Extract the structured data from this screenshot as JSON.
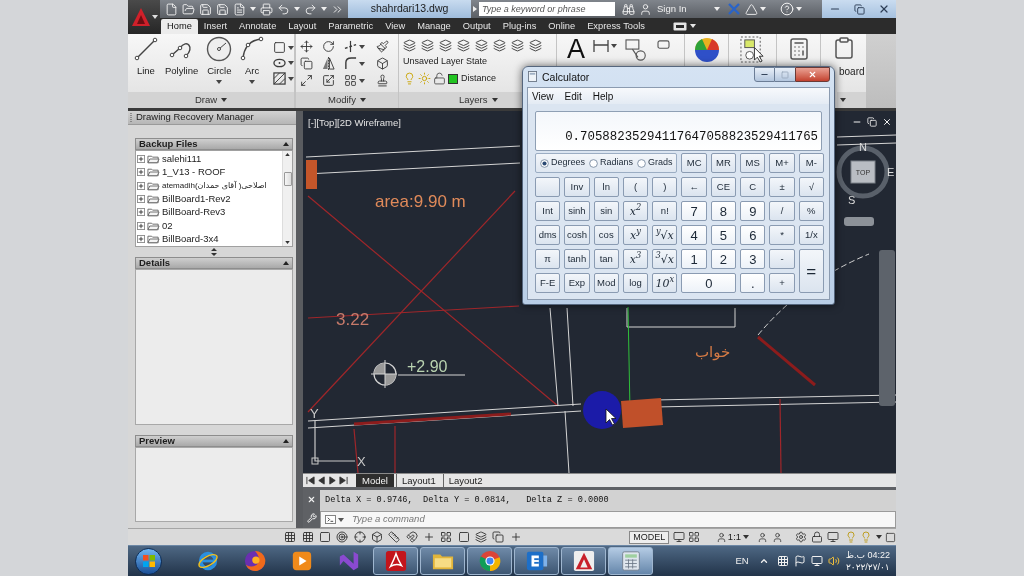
{
  "title_bar": {
    "title": "shahrdari13.dwg",
    "search": {
      "placeholder": "Type a keyword or phrase"
    },
    "sign_in": "Sign In"
  },
  "ribbon": {
    "tabs": [
      {
        "label": "Home",
        "selected": true
      },
      {
        "label": "Insert",
        "selected": false
      },
      {
        "label": "Annotate",
        "selected": false
      },
      {
        "label": "Layout",
        "selected": false
      },
      {
        "label": "Parametric",
        "selected": false
      },
      {
        "label": "View",
        "selected": false
      },
      {
        "label": "Manage",
        "selected": false
      },
      {
        "label": "Output",
        "selected": false
      },
      {
        "label": "Plug-ins",
        "selected": false
      },
      {
        "label": "Online",
        "selected": false
      },
      {
        "label": "Express Tools",
        "selected": false
      }
    ],
    "draw": {
      "label": "Draw",
      "tools": [
        "Line",
        "Polyline",
        "Circle",
        "Arc"
      ]
    },
    "modify": {
      "label": "Modify"
    },
    "layers": {
      "label": "Layers",
      "layer_state": "Unsaved Layer State",
      "current_layer": "Distance"
    },
    "annotation": {
      "text_tool": "A"
    },
    "clipboard": {
      "label": "board"
    }
  },
  "recovery_manager": {
    "title": "Drawing Recovery Manager",
    "backup_files": {
      "title": "Backup Files",
      "files": [
        {
          "name": "salehi111",
          "expanded": false
        },
        {
          "name": "1_V13 - ROOF",
          "expanded": false
        },
        {
          "name": "atemadih(اصلاحی( آقای حمدان",
          "expanded": false
        },
        {
          "name": "BillBoard1-Rev2",
          "expanded": false
        },
        {
          "name": "BillBoard-Rev3",
          "expanded": false
        },
        {
          "name": "02",
          "expanded": false
        },
        {
          "name": "BillBoard-3x4",
          "expanded": false
        }
      ]
    },
    "details": {
      "title": "Details"
    },
    "preview": {
      "title": "Preview"
    }
  },
  "viewport": {
    "label": "[-][Top][2D Wireframe]",
    "annotations": [
      "area:9.90 m",
      "3.22",
      "+2.90",
      "خواب"
    ],
    "viewcube": {
      "north": "N",
      "top": "TOP",
      "east": "E",
      "south": "S"
    },
    "ucs": {
      "y": "Y",
      "x": "X"
    }
  },
  "layout_tabs": [
    {
      "label": "Model",
      "selected": true
    },
    {
      "label": "Layout1",
      "selected": false
    },
    {
      "label": "Layout2",
      "selected": false
    }
  ],
  "command_line": {
    "history": "Delta X = 0.9746,  Delta Y = 0.0814,   Delta Z = 0.0000",
    "placeholder": "Type a command"
  },
  "status_bar": {
    "space": "MODEL",
    "annotation_scale": "1:1"
  },
  "taskbar": {
    "buttons": [
      {
        "running": false,
        "selected": false
      },
      {
        "running": false,
        "selected": false
      },
      {
        "running": false,
        "selected": false
      },
      {
        "running": false,
        "selected": false
      },
      {
        "running": true,
        "selected": false
      },
      {
        "running": true,
        "selected": false
      },
      {
        "running": true,
        "selected": false
      },
      {
        "running": true,
        "selected": false
      },
      {
        "running": true,
        "selected": false
      },
      {
        "running": true,
        "selected": true
      }
    ],
    "language": "EN",
    "time": "04:22 ب.ظ",
    "date": "۲۰۲۲/۲۷/۰۱"
  },
  "calculator": {
    "title": "Calculator",
    "menu": [
      "View",
      "Edit",
      "Help"
    ],
    "display": "0.70588235294117647058823529411765",
    "angle_modes": [
      {
        "label": "Degrees",
        "selected": true
      },
      {
        "label": "Radians",
        "selected": false
      },
      {
        "label": "Grads",
        "selected": false
      }
    ],
    "memory_keys": [
      "MC",
      "MR",
      "MS",
      "M+",
      "M-"
    ],
    "keys": [
      {
        "kind": "blank"
      },
      {
        "label": "Inv",
        "kind": "func"
      },
      {
        "label": "ln",
        "kind": "func"
      },
      {
        "label": "(",
        "kind": "func"
      },
      {
        "label": ")",
        "kind": "func"
      },
      {
        "label": "←",
        "kind": "func"
      },
      {
        "label": "CE",
        "kind": "func"
      },
      {
        "label": "C",
        "kind": "func"
      },
      {
        "label": "±",
        "kind": "func"
      },
      {
        "label": "√",
        "kind": "func"
      },
      {
        "label": "Int",
        "kind": "func"
      },
      {
        "label": "sinh",
        "kind": "func"
      },
      {
        "label": "sin",
        "kind": "func"
      },
      {
        "label": "x$^{2}$",
        "kind": "math"
      },
      {
        "label": "n!",
        "kind": "func"
      },
      {
        "label": "7",
        "kind": "digit"
      },
      {
        "label": "8",
        "kind": "digit"
      },
      {
        "label": "9",
        "kind": "digit"
      },
      {
        "label": "/",
        "kind": "func"
      },
      {
        "label": "%",
        "kind": "func"
      },
      {
        "label": "dms",
        "kind": "func"
      },
      {
        "label": "cosh",
        "kind": "func"
      },
      {
        "label": "cos",
        "kind": "func"
      },
      {
        "label": "x$^{y}$",
        "kind": "math"
      },
      {
        "label": "$^{y}$√x",
        "kind": "math"
      },
      {
        "label": "4",
        "kind": "digit"
      },
      {
        "label": "5",
        "kind": "digit"
      },
      {
        "label": "6",
        "kind": "digit"
      },
      {
        "label": "*",
        "kind": "func"
      },
      {
        "label": "1/x",
        "kind": "func"
      },
      {
        "label": "π",
        "kind": "func"
      },
      {
        "label": "tanh",
        "kind": "func"
      },
      {
        "label": "tan",
        "kind": "func"
      },
      {
        "label": "x$^{3}$",
        "kind": "math"
      },
      {
        "label": "$^{3}$√x",
        "kind": "math"
      },
      {
        "label": "1",
        "kind": "digit"
      },
      {
        "label": "2",
        "kind": "digit"
      },
      {
        "label": "3",
        "kind": "digit"
      },
      {
        "label": "-",
        "kind": "func"
      },
      {
        "label": "=",
        "kind": "equals"
      },
      {
        "label": "F-E",
        "kind": "func"
      },
      {
        "label": "Exp",
        "kind": "func"
      },
      {
        "label": "Mod",
        "kind": "func"
      },
      {
        "label": "log",
        "kind": "func"
      },
      {
        "label": "10$^{x}$",
        "kind": "math"
      },
      {
        "label": "0",
        "kind": "zero"
      },
      {
        "label": ".",
        "kind": "digit"
      },
      {
        "label": "+",
        "kind": "func"
      }
    ]
  }
}
